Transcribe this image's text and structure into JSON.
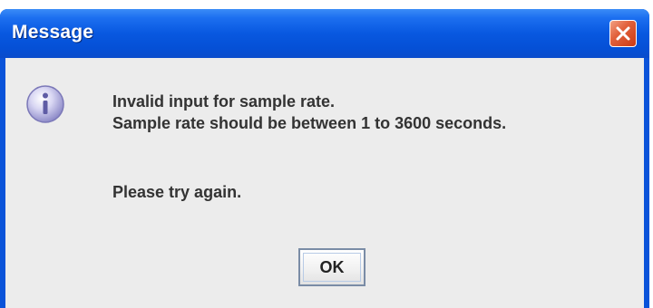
{
  "window": {
    "title": "Message"
  },
  "icons": {
    "close": "close-icon",
    "info": "info-icon"
  },
  "message": {
    "line1": "Invalid input for sample rate.",
    "line2": "Sample rate should be between 1 to 3600 seconds.",
    "line3": "Please try again."
  },
  "buttons": {
    "ok_label": "OK"
  },
  "colors": {
    "titlebar": "#0a53d9",
    "close_button": "#e0532b",
    "content_background": "#ececec"
  }
}
